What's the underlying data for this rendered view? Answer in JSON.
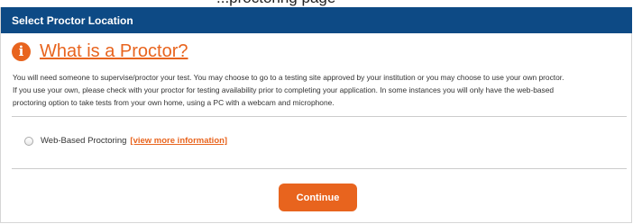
{
  "page_partial_text": "...proctoring page",
  "panel": {
    "title": "Select Proctor Location"
  },
  "info": {
    "icon": "info-icon",
    "icon_glyph": "i",
    "heading": "What is a Proctor?",
    "accent_color": "#e8641e",
    "lines": [
      "You will need someone to supervise/proctor your test. You may choose to go to a testing site approved by your institution or you may choose to use your own proctor.",
      "If you use your own, please check with your proctor for testing availability prior to completing your application. In some instances you will only have the web-based",
      "proctoring option to take tests from your own home, using a PC with a webcam and microphone."
    ]
  },
  "options": [
    {
      "label": "Web-Based Proctoring",
      "link_text": "[view more information]",
      "selected": false
    }
  ],
  "actions": {
    "continue_label": "Continue"
  },
  "colors": {
    "header_bg": "#0d4a85",
    "accent": "#e8641e"
  }
}
